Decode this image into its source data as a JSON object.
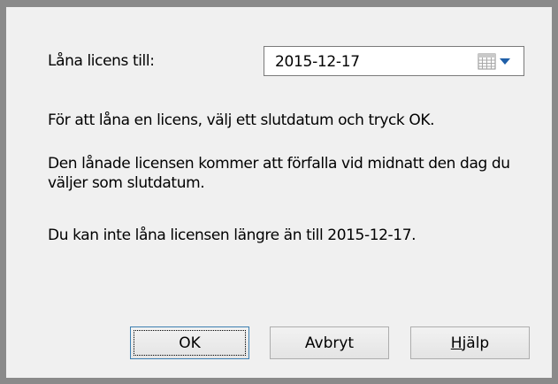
{
  "dialog": {
    "borrow_label": "Låna licens till:",
    "date_value": "2015-12-17",
    "calendar_icon": "calendar-icon",
    "dropdown_icon": "chevron-down-icon",
    "info_line_1": "För att låna en licens, välj ett slutdatum och tryck OK.",
    "info_line_2": "Den lånade licensen kommer att förfalla vid midnatt den dag du väljer som slutdatum.",
    "info_line_3": "Du kan inte låna licensen längre än till 2015-12-17."
  },
  "buttons": {
    "ok_label": "OK",
    "cancel_label": "Avbryt",
    "help_label_first": "H",
    "help_label_rest": "jälp"
  },
  "colors": {
    "dialog_bg": "#f0f0f0",
    "outer_bg": "#8a8a8a",
    "default_button_border": "#3c7fb1",
    "dropdown_arrow": "#1f5fa8"
  }
}
